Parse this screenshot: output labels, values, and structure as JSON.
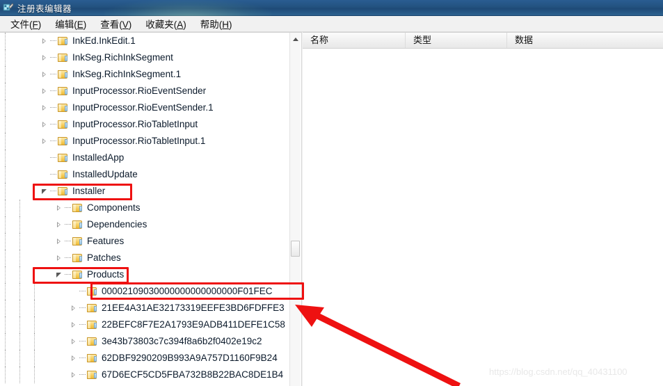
{
  "window": {
    "title": "注册表编辑器",
    "icon": "registry-editor-icon"
  },
  "menubar": {
    "items": [
      {
        "label": "文件",
        "accel": "F"
      },
      {
        "label": "编辑",
        "accel": "E"
      },
      {
        "label": "查看",
        "accel": "V"
      },
      {
        "label": "收藏夹",
        "accel": "A"
      },
      {
        "label": "帮助",
        "accel": "H"
      }
    ]
  },
  "tree": {
    "rows": [
      {
        "label": "InkEd.InkEdit.1",
        "indent": 0,
        "state": "collapsed"
      },
      {
        "label": "InkSeg.RichInkSegment",
        "indent": 0,
        "state": "collapsed"
      },
      {
        "label": "InkSeg.RichInkSegment.1",
        "indent": 0,
        "state": "collapsed"
      },
      {
        "label": "InputProcessor.RioEventSender",
        "indent": 0,
        "state": "collapsed"
      },
      {
        "label": "InputProcessor.RioEventSender.1",
        "indent": 0,
        "state": "collapsed"
      },
      {
        "label": "InputProcessor.RioTabletInput",
        "indent": 0,
        "state": "collapsed"
      },
      {
        "label": "InputProcessor.RioTabletInput.1",
        "indent": 0,
        "state": "collapsed"
      },
      {
        "label": "InstalledApp",
        "indent": 0,
        "state": "leaf"
      },
      {
        "label": "InstalledUpdate",
        "indent": 0,
        "state": "leaf"
      },
      {
        "label": "Installer",
        "indent": 0,
        "state": "expanded"
      },
      {
        "label": "Components",
        "indent": 1,
        "state": "collapsed"
      },
      {
        "label": "Dependencies",
        "indent": 1,
        "state": "collapsed"
      },
      {
        "label": "Features",
        "indent": 1,
        "state": "collapsed"
      },
      {
        "label": "Patches",
        "indent": 1,
        "state": "collapsed"
      },
      {
        "label": "Products",
        "indent": 1,
        "state": "expanded"
      },
      {
        "label": "00002109030000000000000000F01FEC",
        "indent": 2,
        "state": "leaf"
      },
      {
        "label": "21EE4A31AE32173319EEFE3BD6FDFFE3",
        "indent": 2,
        "state": "collapsed"
      },
      {
        "label": "22BEFC8F7E2A1793E9ADB411DEFE1C58",
        "indent": 2,
        "state": "collapsed"
      },
      {
        "label": "3e43b73803c7c394f8a6b2f0402e19c2",
        "indent": 2,
        "state": "collapsed"
      },
      {
        "label": "62DBF9290209B993A9A757D1160F9B24",
        "indent": 2,
        "state": "collapsed"
      },
      {
        "label": "67D6ECF5CD5FBA732B8B22BAC8DE1B4",
        "indent": 2,
        "state": "collapsed"
      }
    ]
  },
  "annotations": {
    "highlight_installer": "Installer",
    "highlight_products": "Products",
    "highlight_product_key": "00002109030000000000000000F01FEC",
    "arrow_target": "21EE4A31AE32173319EEFE3BD6FDFFE3",
    "color": "#ee1111"
  },
  "list": {
    "columns": [
      {
        "label": "名称"
      },
      {
        "label": "类型"
      },
      {
        "label": "数据"
      }
    ],
    "rows": []
  },
  "scrollbar": {
    "up_arrow": "scroll-up-arrow",
    "thumb": "scroll-thumb"
  },
  "watermark": {
    "text": "https://blog.csdn.net/qq_40431100"
  }
}
